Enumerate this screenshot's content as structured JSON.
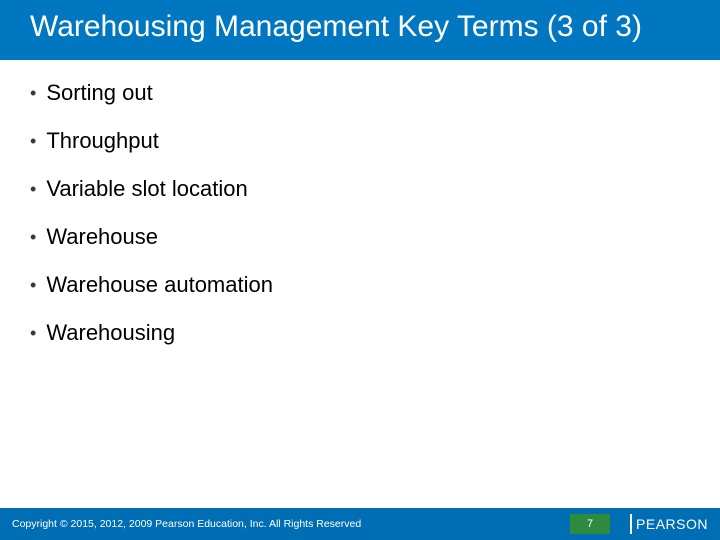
{
  "title": "Warehousing Management Key Terms (3 of 3)",
  "terms": [
    "Sorting out",
    "Throughput",
    "Variable slot location",
    "Warehouse",
    "Warehouse automation",
    "Warehousing"
  ],
  "footer": {
    "copyright": "Copyright © 2015, 2012, 2009 Pearson Education, Inc. All Rights Reserved",
    "page": "7",
    "brand": "PEARSON"
  }
}
